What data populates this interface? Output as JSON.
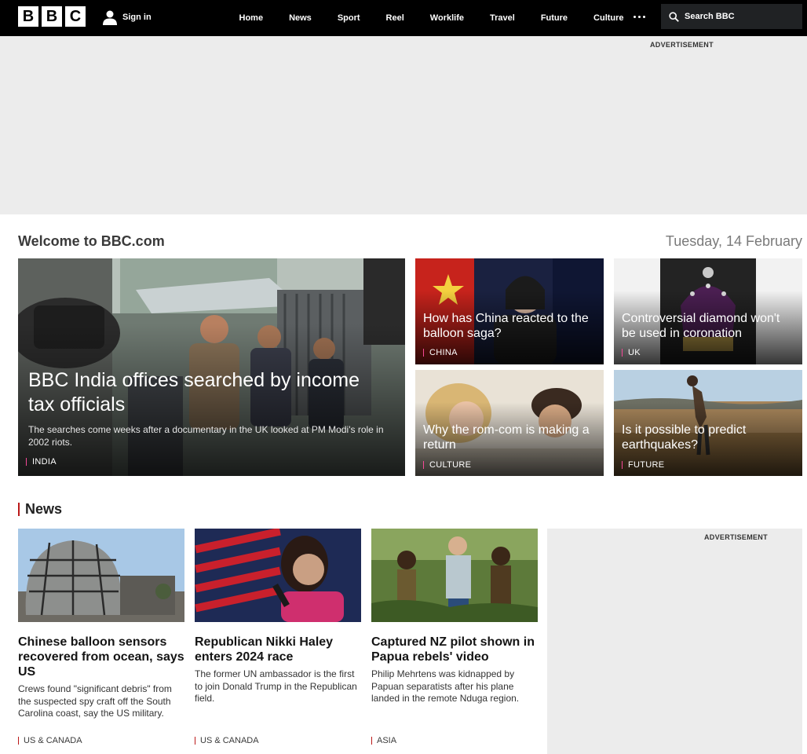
{
  "header": {
    "logo": [
      "B",
      "B",
      "C"
    ],
    "signin_label": "Sign in",
    "nav": [
      "Home",
      "News",
      "Sport",
      "Reel",
      "Worklife",
      "Travel",
      "Future",
      "Culture"
    ],
    "more_icon": "more-dots-icon",
    "search_placeholder": "Search BBC"
  },
  "ads": {
    "top_label": "ADVERTISEMENT",
    "side_label": "ADVERTISEMENT"
  },
  "welcome": {
    "title": "Welcome to BBC.com",
    "date": "Tuesday, 14 February"
  },
  "hero": {
    "title": "BBC India offices searched by income tax officials",
    "summary": "The searches come weeks after a documentary in the UK looked at PM Modi's role in 2002 riots.",
    "tag": "INDIA"
  },
  "cards": [
    {
      "title": "How has China reacted to the balloon saga?",
      "tag": "CHINA"
    },
    {
      "title": "Controversial diamond won't be used in coronation",
      "tag": "UK"
    },
    {
      "title": "Why the rom-com is making a return",
      "tag": "CULTURE"
    },
    {
      "title": "Is it possible to predict earthquakes?",
      "tag": "FUTURE"
    }
  ],
  "news": {
    "heading": "News",
    "stories": [
      {
        "title": "Chinese balloon sensors recovered from ocean, says US",
        "summary": "Crews found \"significant debris\" from the suspected spy craft off the South Carolina coast, say the US military.",
        "tag": "US & CANADA"
      },
      {
        "title": "Republican Nikki Haley enters 2024 race",
        "summary": "The former UN ambassador is the first to join Donald Trump in the Republican field.",
        "tag": "US & CANADA"
      },
      {
        "title": "Captured NZ pilot shown in Papua rebels' video",
        "summary": "Philip Mehrtens was kidnapped by Papuan separatists after his plane landed in the remote Nduga region.",
        "tag": "ASIA"
      }
    ]
  },
  "colors": {
    "header_bg": "#000000",
    "ad_bg": "#ececec",
    "news_accent": "#bb1919",
    "card_tag_accent": "#f54997"
  }
}
